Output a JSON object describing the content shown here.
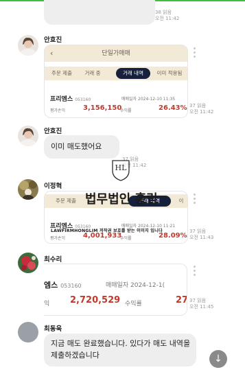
{
  "messages": {
    "m0": {
      "read": "38 읽음",
      "time": "오전 11:42"
    },
    "m1": {
      "sender": "안효진",
      "card_title": "단일가매매",
      "tabs": [
        "주문 제출",
        "거래 중",
        "거래 내역",
        "이미 적용됨"
      ],
      "stock": "프리엠스",
      "code": "053160",
      "date_label": "매매일자",
      "date": "2024-12-10 11:35",
      "pl_label": "평가손익",
      "pl": "3,156,150",
      "rate_label": "수익률",
      "rate": "26.43%",
      "read": "37 읽음",
      "time": "오전 11:42"
    },
    "m2": {
      "sender": "안효진",
      "text": "이미 매도했어요",
      "read": "37 읽음",
      "time": "오전 11:42"
    },
    "m3": {
      "sender": "이정혁",
      "tabs": [
        "주문 제출",
        "거래 내역",
        "이"
      ],
      "stock": "프리엠스",
      "code": "053160",
      "date_label": "매매일자",
      "date": "2024-12-10 11:21",
      "pl_label": "평가손익",
      "pl": "4,001,933",
      "rate_label": "수익률",
      "rate": "28.09%",
      "read": "37 읽음",
      "time": "오전 11:43"
    },
    "m4": {
      "sender": "최수리",
      "stock": "엠스",
      "code": "053160",
      "date_label": "매매일자",
      "date": "2024-12-1(",
      "pl_label": "익",
      "pl": "2,720,529",
      "rate_label": "수익률",
      "rate": "27.",
      "read": "37 읽음",
      "time": "오전 11:45"
    },
    "m5": {
      "sender": "최동욱",
      "text": "지금 매도 완료했습니다. 있다가 매도 내역을 제출하겠습니다"
    }
  },
  "watermark": {
    "logo": "HL",
    "title": "법무법인 홍림",
    "subtitle": "LAWFIRMHONGLIM 저작권 보호를 받는 이미지 입니다"
  },
  "colors": {
    "accent_red": "#c0392b",
    "card_header": "#f2e9d7",
    "active_tab": "#17213b",
    "bubble": "#eeeeee"
  },
  "icons": {
    "back": "chevron-left-icon",
    "more": "more-vertical-icon",
    "scroll": "arrow-down-icon"
  }
}
